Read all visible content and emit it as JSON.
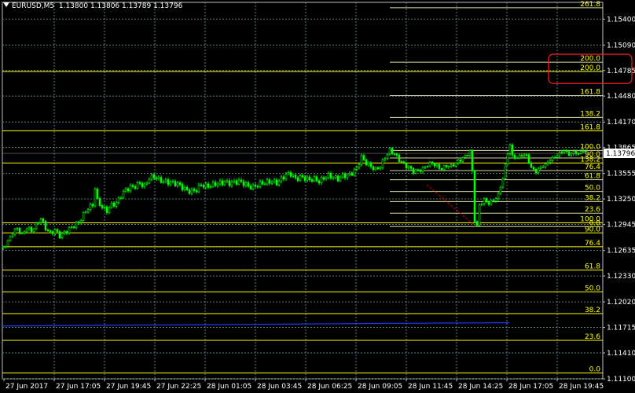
{
  "header": {
    "symbol": "EURUSD,M5",
    "ohlc": "1.13800 1.13806 1.13789 1.13796"
  },
  "colors": {
    "background": "#000000",
    "grid": "#5c7e84",
    "candle": "#00ff00",
    "fib": "#ffff00",
    "ma": "#1a3cff",
    "highlight": "#ff2020",
    "trendline": "#cc0000",
    "axis_text": "#ffffff",
    "price_box_bg": "#ffffff"
  },
  "chart_data": {
    "type": "candlestick",
    "symbol": "EURUSD",
    "timeframe": "M5",
    "ylim": [
      1.111,
      1.156
    ],
    "y_ticks": [
      "1.15400",
      "1.15090",
      "1.14785",
      "1.14480",
      "1.14170",
      "1.13865",
      "1.13555",
      "1.13250",
      "1.12945",
      "1.12635",
      "1.12330",
      "1.12020",
      "1.11715",
      "1.11410",
      "1.11100"
    ],
    "x_ticks": [
      "27 Jun 2017",
      "27 Jun 17:05",
      "27 Jun 19:45",
      "27 Jun 22:25",
      "28 Jun 01:05",
      "28 Jun 03:45",
      "28 Jun 06:25",
      "28 Jun 09:05",
      "28 Jun 11:45",
      "28 Jun 14:25",
      "28 Jun 17:05",
      "28 Jun 19:45"
    ],
    "current_price": "1.13796",
    "close_path": [
      [
        0,
        1.1267
      ],
      [
        6,
        1.1274
      ],
      [
        12,
        1.1285
      ],
      [
        18,
        1.129
      ],
      [
        24,
        1.1282
      ],
      [
        30,
        1.1291
      ],
      [
        36,
        1.1287
      ],
      [
        42,
        1.1294
      ],
      [
        48,
        1.1302
      ],
      [
        54,
        1.129
      ],
      [
        60,
        1.1284
      ],
      [
        66,
        1.1288
      ],
      [
        72,
        1.1281
      ],
      [
        78,
        1.1285
      ],
      [
        84,
        1.1289
      ],
      [
        90,
        1.1293
      ],
      [
        96,
        1.1297
      ],
      [
        102,
        1.1306
      ],
      [
        108,
        1.1314
      ],
      [
        114,
        1.1318
      ],
      [
        117,
        1.1338
      ],
      [
        120,
        1.1323
      ],
      [
        126,
        1.1315
      ],
      [
        132,
        1.1311
      ],
      [
        138,
        1.1318
      ],
      [
        144,
        1.132
      ],
      [
        150,
        1.1329
      ],
      [
        156,
        1.1336
      ],
      [
        162,
        1.1339
      ],
      [
        168,
        1.134
      ],
      [
        174,
        1.1344
      ],
      [
        180,
        1.134
      ],
      [
        186,
        1.135
      ],
      [
        192,
        1.1352
      ],
      [
        198,
        1.1348
      ],
      [
        204,
        1.1346
      ],
      [
        210,
        1.1345
      ],
      [
        216,
        1.1344
      ],
      [
        222,
        1.1343
      ],
      [
        228,
        1.1339
      ],
      [
        234,
        1.1335
      ],
      [
        240,
        1.1334
      ],
      [
        246,
        1.1336
      ],
      [
        252,
        1.1342
      ],
      [
        258,
        1.134
      ],
      [
        264,
        1.1341
      ],
      [
        270,
        1.1343
      ],
      [
        276,
        1.1344
      ],
      [
        282,
        1.1345
      ],
      [
        288,
        1.1344
      ],
      [
        294,
        1.1345
      ],
      [
        300,
        1.1346
      ],
      [
        306,
        1.1344
      ],
      [
        312,
        1.134
      ],
      [
        318,
        1.1339
      ],
      [
        324,
        1.1342
      ],
      [
        330,
        1.1344
      ],
      [
        336,
        1.1345
      ],
      [
        342,
        1.1346
      ],
      [
        348,
        1.1344
      ],
      [
        354,
        1.1349
      ],
      [
        360,
        1.1354
      ],
      [
        366,
        1.1355
      ],
      [
        372,
        1.1349
      ],
      [
        378,
        1.1351
      ],
      [
        384,
        1.135
      ],
      [
        390,
        1.1348
      ],
      [
        396,
        1.1349
      ],
      [
        402,
        1.1346
      ],
      [
        408,
        1.135
      ],
      [
        414,
        1.1353
      ],
      [
        420,
        1.1351
      ],
      [
        426,
        1.1349
      ],
      [
        432,
        1.1353
      ],
      [
        438,
        1.1353
      ],
      [
        444,
        1.1356
      ],
      [
        450,
        1.1362
      ],
      [
        456,
        1.1375
      ],
      [
        462,
        1.1368
      ],
      [
        468,
        1.1364
      ],
      [
        474,
        1.136
      ],
      [
        480,
        1.1364
      ],
      [
        486,
        1.1375
      ],
      [
        492,
        1.1383
      ],
      [
        498,
        1.1379
      ],
      [
        504,
        1.1372
      ],
      [
        510,
        1.1366
      ],
      [
        516,
        1.1363
      ],
      [
        522,
        1.1358
      ],
      [
        528,
        1.1359
      ],
      [
        534,
        1.1361
      ],
      [
        540,
        1.1366
      ],
      [
        546,
        1.1368
      ],
      [
        552,
        1.1364
      ],
      [
        558,
        1.1361
      ],
      [
        564,
        1.1365
      ],
      [
        570,
        1.1364
      ],
      [
        576,
        1.1368
      ],
      [
        582,
        1.1372
      ],
      [
        588,
        1.1376
      ],
      [
        594,
        1.1382
      ],
      [
        597,
        1.1358
      ],
      [
        600,
        1.13
      ],
      [
        603,
        1.1292
      ],
      [
        606,
        1.1318
      ],
      [
        612,
        1.1324
      ],
      [
        618,
        1.132
      ],
      [
        624,
        1.1323
      ],
      [
        630,
        1.133
      ],
      [
        636,
        1.135
      ],
      [
        642,
        1.138
      ],
      [
        645,
        1.139
      ],
      [
        648,
        1.1376
      ],
      [
        654,
        1.1374
      ],
      [
        660,
        1.1378
      ],
      [
        666,
        1.1377
      ],
      [
        672,
        1.1362
      ],
      [
        678,
        1.1358
      ],
      [
        684,
        1.1363
      ],
      [
        690,
        1.1366
      ],
      [
        696,
        1.1372
      ],
      [
        702,
        1.1375
      ],
      [
        708,
        1.138
      ],
      [
        714,
        1.1383
      ],
      [
        720,
        1.1378
      ],
      [
        726,
        1.1381
      ],
      [
        732,
        1.1379
      ],
      [
        738,
        1.1383
      ],
      [
        742,
        1.138
      ]
    ],
    "ma_path": [
      [
        0,
        1.11732
      ],
      [
        100,
        1.11739
      ],
      [
        200,
        1.11744
      ],
      [
        300,
        1.1175
      ],
      [
        400,
        1.11757
      ],
      [
        500,
        1.11764
      ],
      [
        600,
        1.11769
      ],
      [
        645,
        1.1177
      ]
    ],
    "fib_lines": [
      {
        "label": "261.8",
        "price": 1.15535,
        "start": 493
      },
      {
        "label": "200.0",
        "price": 1.14885,
        "start": 493
      },
      {
        "label": "200.0",
        "price": 1.14775,
        "start": 0
      },
      {
        "label": "161.8",
        "price": 1.14485,
        "start": 493
      },
      {
        "label": "138.2",
        "price": 1.14225,
        "start": 493
      },
      {
        "label": "161.8",
        "price": 1.14065,
        "start": 0
      },
      {
        "label": "100.0",
        "price": 1.1383,
        "start": 493
      },
      {
        "label": "90.0",
        "price": 1.1374,
        "start": 493
      },
      {
        "label": "76.4",
        "price": 1.1359,
        "start": 493
      },
      {
        "label": "138.2",
        "price": 1.1368,
        "start": 0
      },
      {
        "label": "61.8",
        "price": 1.1348,
        "start": 493
      },
      {
        "label": "50.0",
        "price": 1.1334,
        "start": 493
      },
      {
        "label": "38.2",
        "price": 1.1322,
        "start": 493
      },
      {
        "label": "23.6",
        "price": 1.1308,
        "start": 493
      },
      {
        "label": "0.0",
        "price": 1.1292,
        "start": 493
      },
      {
        "label": "100.0",
        "price": 1.12965,
        "start": 0
      },
      {
        "label": "90.0",
        "price": 1.12845,
        "start": 0
      },
      {
        "label": "76.4",
        "price": 1.1268,
        "start": 0
      },
      {
        "label": "61.8",
        "price": 1.124,
        "start": 0
      },
      {
        "label": "50.0",
        "price": 1.1214,
        "start": 0
      },
      {
        "label": "38.2",
        "price": 1.1188,
        "start": 0
      },
      {
        "label": "23.6",
        "price": 1.1156,
        "start": 0
      },
      {
        "label": "0.0",
        "price": 1.1117,
        "start": 0
      }
    ],
    "trendline": {
      "from": [
        540,
        1.1342
      ],
      "to": [
        603,
        1.1292
      ]
    }
  }
}
